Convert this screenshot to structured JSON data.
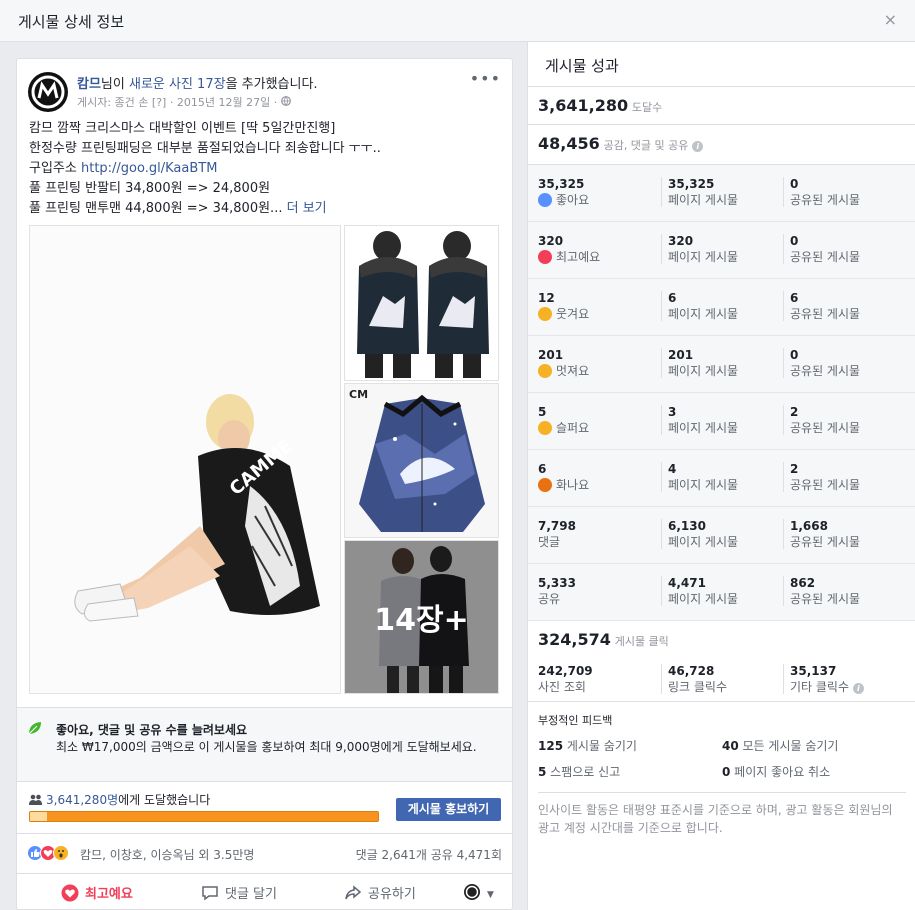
{
  "dialog": {
    "title": "게시물 상세 정보",
    "close": "×"
  },
  "post": {
    "author": "캄므",
    "action_prefix": "님이 ",
    "action_link": "새로운 사진 17장",
    "action_suffix": "을 추가했습니다.",
    "meta_poster": "게시자: 종건 손",
    "meta_flag": "[?]",
    "meta_date": "2015년 12월 27일",
    "meta_sep": "·",
    "more": "•••",
    "text_lines": [
      "캄므 깜짝 크리스마스 대박할인 이벤트 [딱 5일간만진행]",
      "한정수량 프린팅패딩은 대부분 품절되었습니다 죄송합니다 ㅜㅜ.."
    ],
    "buy_label": "구입주소 ",
    "buy_url": "http://goo.gl/KaaBTM",
    "price_line1": "풀 프린팅 반팔티 34,800원 => 24,800원",
    "price_line2": "풀 프린팅 맨투맨 44,800원 => 34,800원...",
    "see_more": " 더 보기",
    "photo_more": "14장+",
    "photo_logo": "CM"
  },
  "boost": {
    "title": "좋아요, 댓글 및 공유 수를 늘려보세요",
    "desc": "최소 ₩17,000의 금액으로 이 게시물을 홍보하여 최대 9,000명에게 도달해보세요.",
    "reach_number": "3,641,280명",
    "reach_suffix": "에게 도달했습니다",
    "organic_fraction": 0.05,
    "button": "게시물 홍보하기"
  },
  "reactions_bar": {
    "names": "캄므, 이창호, 이승옥님 외 3.5만명",
    "counts": "댓글 2,641개   공유 4,471회"
  },
  "actions": {
    "love": "최고예요",
    "comment": "댓글 달기",
    "share": "공유하기"
  },
  "insights": {
    "title": "게시물 성과",
    "reach": "3,641,280",
    "reach_label": "도달수",
    "engagement": "48,456",
    "engagement_label": "공감, 댓글 및 공유",
    "rows": [
      {
        "total": "35,325",
        "label": "좋아요",
        "emoji": "like",
        "page": "35,325",
        "page_label": "페이지 게시물",
        "shared": "0",
        "shared_label": "공유된 게시물"
      },
      {
        "total": "320",
        "label": "최고예요",
        "emoji": "love",
        "page": "320",
        "page_label": "페이지 게시물",
        "shared": "0",
        "shared_label": "공유된 게시물"
      },
      {
        "total": "12",
        "label": "웃겨요",
        "emoji": "haha",
        "page": "6",
        "page_label": "페이지 게시물",
        "shared": "6",
        "shared_label": "공유된 게시물"
      },
      {
        "total": "201",
        "label": "멋져요",
        "emoji": "wow",
        "page": "201",
        "page_label": "페이지 게시물",
        "shared": "0",
        "shared_label": "공유된 게시물"
      },
      {
        "total": "5",
        "label": "슬퍼요",
        "emoji": "sad",
        "page": "3",
        "page_label": "페이지 게시물",
        "shared": "2",
        "shared_label": "공유된 게시물"
      },
      {
        "total": "6",
        "label": "화나요",
        "emoji": "angry",
        "page": "4",
        "page_label": "페이지 게시물",
        "shared": "2",
        "shared_label": "공유된 게시물"
      },
      {
        "total": "7,798",
        "label": "댓글",
        "emoji": "",
        "page": "6,130",
        "page_label": "페이지 게시물",
        "shared": "1,668",
        "shared_label": "공유된 게시물"
      },
      {
        "total": "5,333",
        "label": "공유",
        "emoji": "",
        "page": "4,471",
        "page_label": "페이지 게시물",
        "shared": "862",
        "shared_label": "공유된 게시물"
      }
    ],
    "clicks": "324,574",
    "clicks_label": "게시물 클릭",
    "photo_views": "242,709",
    "photo_views_label": "사진 조회",
    "link_clicks": "46,728",
    "link_clicks_label": "링크 클릭수",
    "other_clicks": "35,137",
    "other_clicks_label": "기타 클릭수",
    "negative_title": "부정적인 피드백",
    "neg1_num": "125",
    "neg1_label": " 게시물 숨기기",
    "neg2_num": "40",
    "neg2_label": " 모든 게시물 숨기기",
    "neg3_num": "5",
    "neg3_label": " 스팸으로 신고",
    "neg4_num": "0",
    "neg4_label": " 페이지 좋아요 취소",
    "footnote": "인사이트 활동은 태평양 표준시를 기준으로 하며, 광고 활동은 회원님의 광고 계정 시간대를 기준으로 합니다."
  },
  "colors": {
    "accent": "#4267b2",
    "link": "#365899",
    "reach_paid": "#f7931e",
    "reach_organic": "#ffdb9e",
    "love": "#f33e58"
  }
}
